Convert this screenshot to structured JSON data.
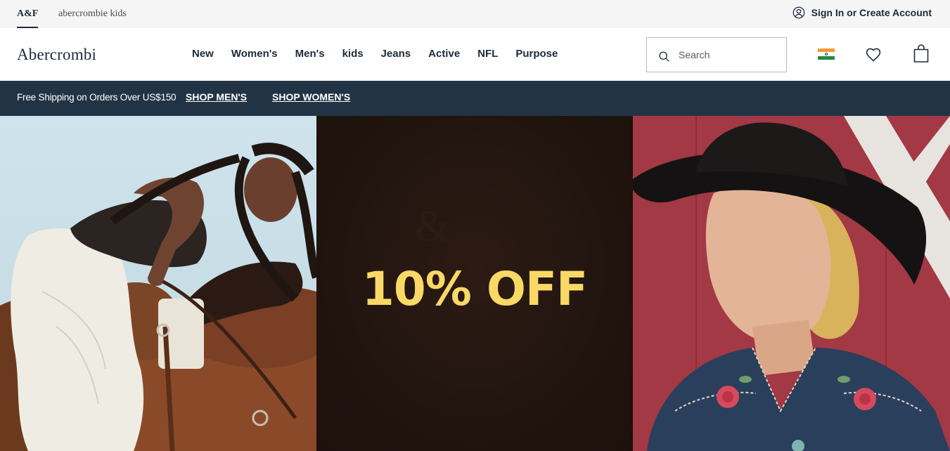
{
  "utility": {
    "tab_af": "A&F",
    "tab_kids": "abercrombie kids",
    "signin": "Sign In or Create Account"
  },
  "header": {
    "logo": "Abercrombi",
    "nav": [
      "New",
      "Women's",
      "Men's",
      "kids",
      "Jeans",
      "Active",
      "NFL",
      "Purpose"
    ],
    "search_placeholder": "Search"
  },
  "promo": {
    "text": "Free Shipping on Orders Over US$150",
    "shop_men": "SHOP MEN'S",
    "shop_women": "SHOP WOMEN'S"
  },
  "hero": {
    "offer": "10% OFF"
  },
  "colors": {
    "navy": "#233346",
    "offer_yellow": "#f9d866",
    "hero_middle": "#21140f",
    "hero_right": "#a23944"
  },
  "icons": [
    "account-icon",
    "search-icon",
    "india-flag-icon",
    "heart-icon",
    "shopping-bag-icon"
  ]
}
